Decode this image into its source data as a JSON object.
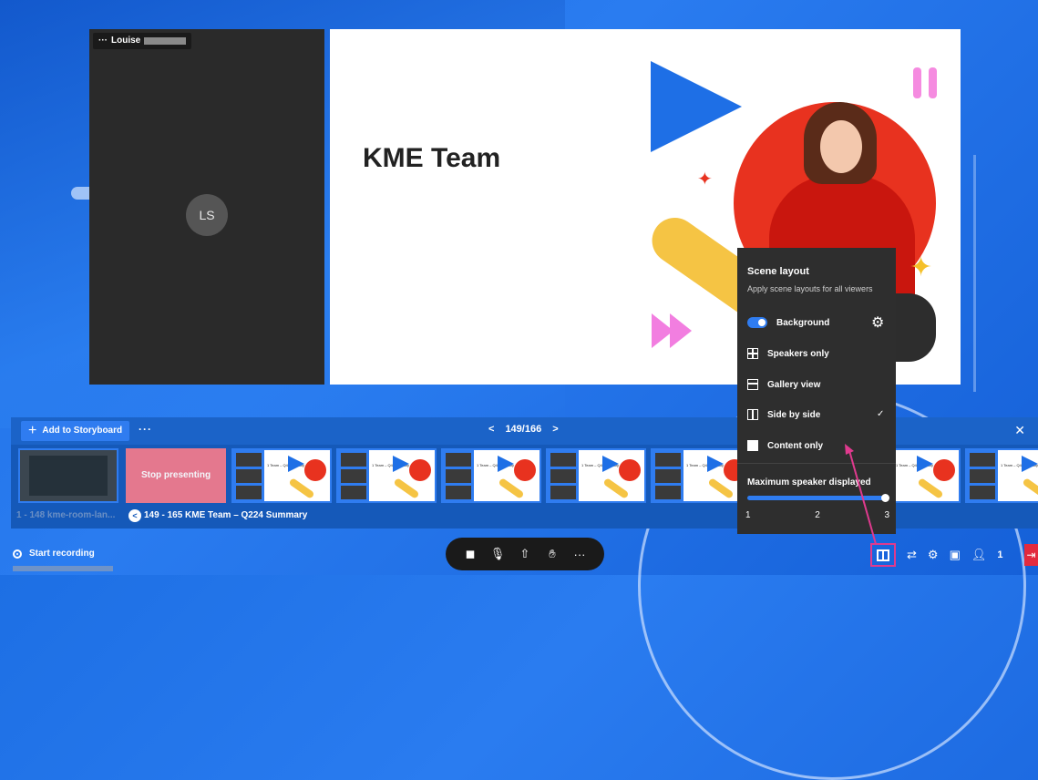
{
  "participant": {
    "name": "Louise",
    "menu": "···",
    "initials": "LS"
  },
  "slide": {
    "title": "KME Team"
  },
  "storyboard": {
    "add_label": "Add to Storyboard",
    "more": "···",
    "prev": "<",
    "page": "149/166",
    "next": ">",
    "close": "✕",
    "stop_presenting": "Stop presenting",
    "group_a": "1 - 148 kme-room-lan...",
    "group_b": "149 - 165 KME Team – Q224 Summary",
    "thumb_title": "1 Team –\nQ4 Summary"
  },
  "bottom": {
    "record_label": "Start recording",
    "participants_count": "1",
    "controls": [
      "camera-off",
      "microphone",
      "share",
      "raise-hand",
      "more"
    ]
  },
  "scene_layout": {
    "title": "Scene layout",
    "subtitle": "Apply scene layouts for all viewers",
    "background_label": "Background",
    "options": [
      {
        "label": "Speakers only",
        "icon": "grid-icon",
        "selected": false
      },
      {
        "label": "Gallery view",
        "icon": "gallery-icon",
        "selected": false
      },
      {
        "label": "Side by side",
        "icon": "side-by-side-icon",
        "selected": true
      },
      {
        "label": "Content only",
        "icon": "content-only-icon",
        "selected": false
      }
    ],
    "check": "✓",
    "max_speaker_label": "Maximum speaker displayed",
    "max_speaker_value": 3,
    "ticks": [
      "1",
      "2",
      "3"
    ]
  },
  "colors": {
    "accent": "#2f7cf0",
    "highlight": "#e03a8e",
    "leave": "#e22a3e"
  }
}
